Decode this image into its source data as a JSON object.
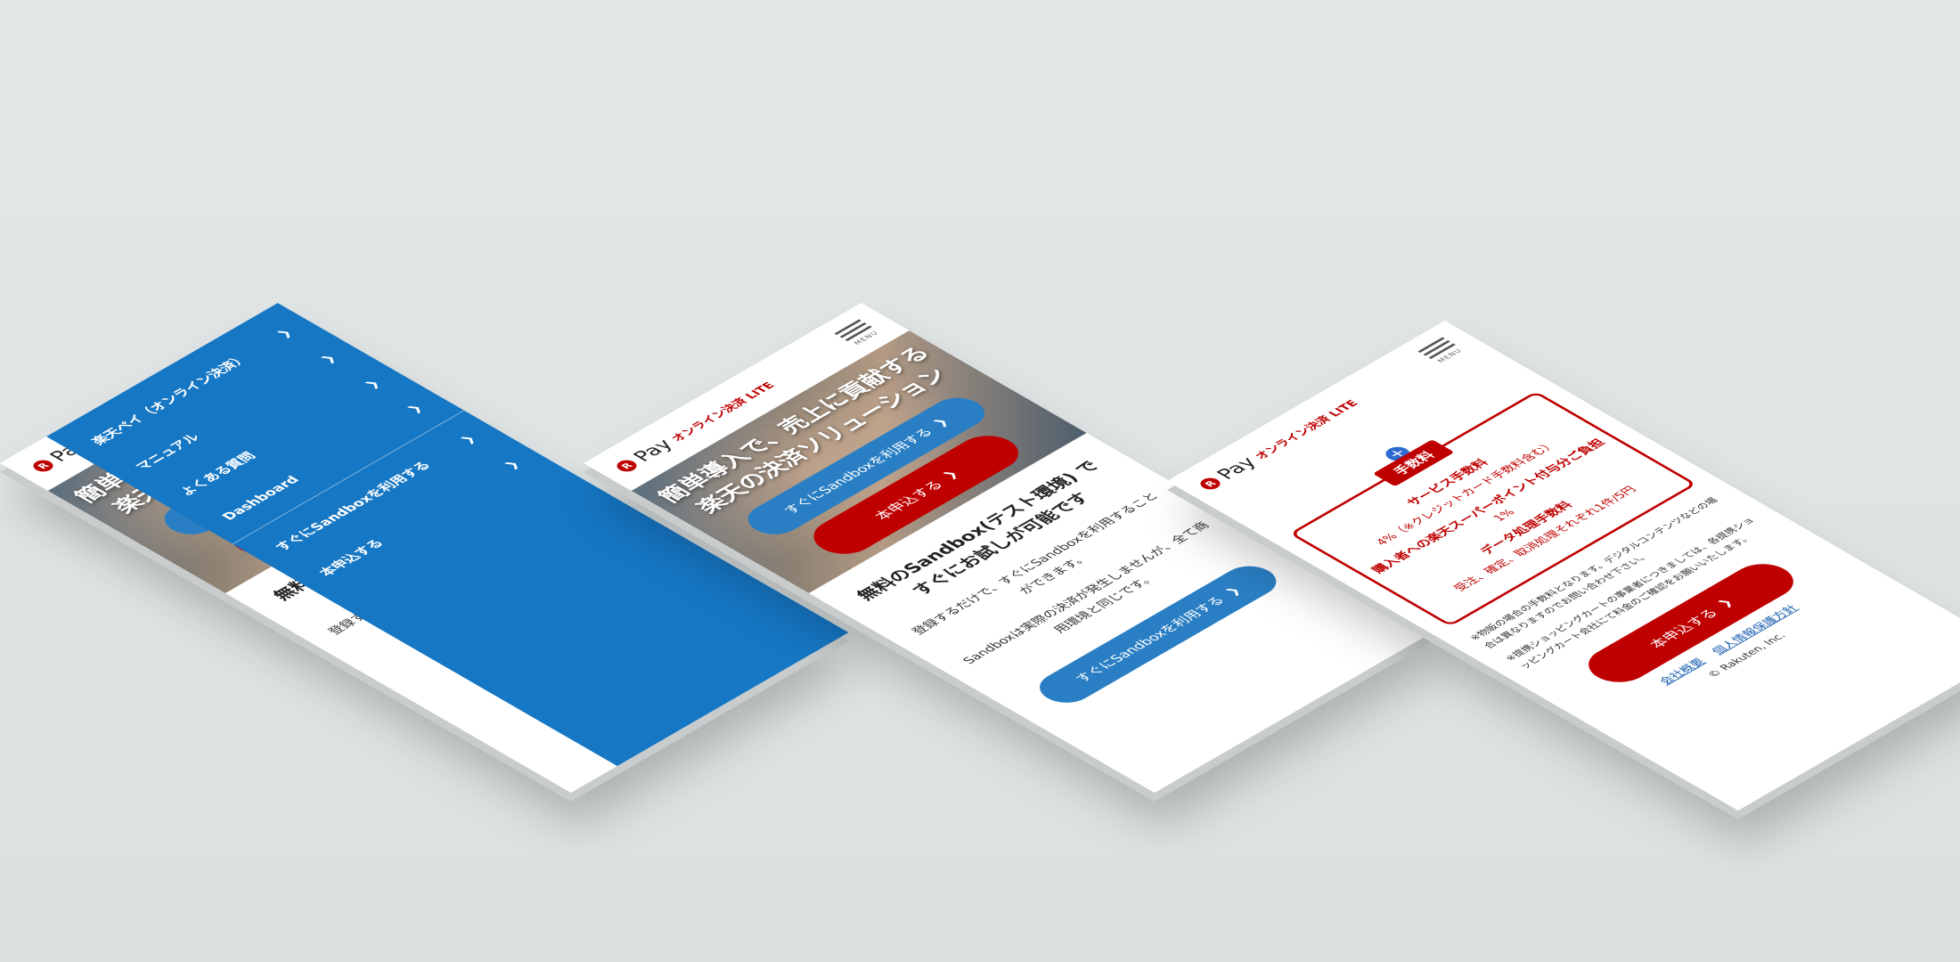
{
  "brand": {
    "badge": "R",
    "pay": "Pay",
    "sub": "オンライン決済 LITE"
  },
  "menu_button_label": "MENU",
  "menu": {
    "items": [
      {
        "label": "楽天ペイ（オンライン決済）"
      },
      {
        "label": "マニュアル"
      },
      {
        "label": "よくある質問"
      },
      {
        "label": "Dashboard"
      }
    ],
    "cta_items": [
      {
        "label": "すぐにSandboxを利用する"
      },
      {
        "label": "本申込する"
      }
    ]
  },
  "hero": {
    "title_line1": "簡単導入で、売上に貢献する",
    "title_line2": "楽天の決済ソリューション",
    "sandbox_button": "すぐにSandboxを利用する",
    "apply_button": "本申込する"
  },
  "sandbox_section": {
    "heading_line1": "無料のSandbox(テスト環境) で",
    "heading_line2": "すぐにお試しが可能です",
    "body_line1": "登録するだけで、すぐにSandboxを利用することができます。",
    "body_line2": "Sandboxは実際の決済が発生しませんが、全て商用環境と同じです。",
    "sandbox_button": "すぐにSandboxを利用する"
  },
  "fees": {
    "tag": "手数料",
    "service_fee_heading": "サービス手数料",
    "service_fee_value": "4%（※クレジットカード手数料含む）",
    "points_heading": "購入者への楽天スーパーポイント付与分ご負担",
    "points_value": "1%",
    "data_heading": "データ処理手数料",
    "data_value": "受注、確定、取消処理それぞれ1件/5円"
  },
  "notes": {
    "note1": "※物販の場合の手数料となります。デジタルコンテンツなどの場合は異なりますのでお問い合わせ下さい。",
    "note2": "※提携ショッピングカートの事業者につきましては、各提携ショッピングカート会社にて料金のご確認をお願いいたします。"
  },
  "apply_button": "本申込する",
  "footer": {
    "company_link": "会社概要",
    "privacy_link": "個人情報保護方針",
    "copyright": "© Rakuten, Inc."
  },
  "colors": {
    "brand_red": "#bf0000",
    "brand_blue": "#2a7fc4",
    "menu_blue": "#1677c4",
    "background": "#dfe3e3"
  }
}
